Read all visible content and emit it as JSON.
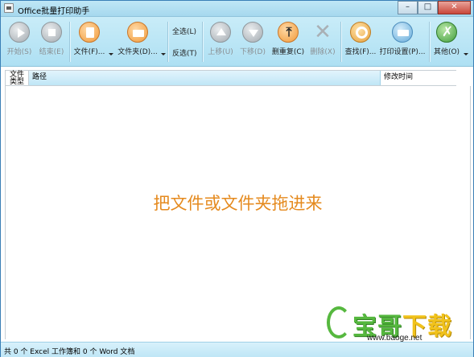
{
  "window": {
    "title": "Office批量打印助手",
    "minimize": "–",
    "maximize": "□",
    "close": "✕"
  },
  "toolbar": {
    "start": "开始(S)",
    "end": "结束(E)",
    "file": "文件(F)...",
    "folder": "文件夹(D)...",
    "select_all": "全选(L)",
    "invert": "反选(T)",
    "move_up": "上移(U)",
    "move_down": "下移(D)",
    "dedupe": "删重复(C)",
    "delete": "删除(X)",
    "find": "查找(F)...",
    "print_settings": "打印设置(P)...",
    "other": "其他(O)"
  },
  "table": {
    "col_type_line1": "文件",
    "col_type_line2": "类型",
    "col_path": "路径",
    "col_mtime": "修改时间"
  },
  "drop_hint": "把文件或文件夹拖进来",
  "watermark": {
    "brand_green": "宝哥",
    "brand_yellow": "下载",
    "url": "www.baoge.net"
  },
  "status": "共 0 个 Excel 工作簿和 0 个 Word 文档",
  "colors": {
    "accent": "#aee0f3",
    "hint_orange": "#e58a1e",
    "watermark_green": "#56b83f"
  },
  "icons": {
    "start": "play-icon",
    "end": "stop-icon",
    "file": "document-icon",
    "folder": "folder-icon",
    "move_up": "arrow-up-icon",
    "move_down": "arrow-down-icon",
    "dedupe": "merge-icon",
    "delete": "x-icon",
    "find": "magnifier-icon",
    "print_settings": "printer-icon",
    "other": "tools-icon"
  }
}
